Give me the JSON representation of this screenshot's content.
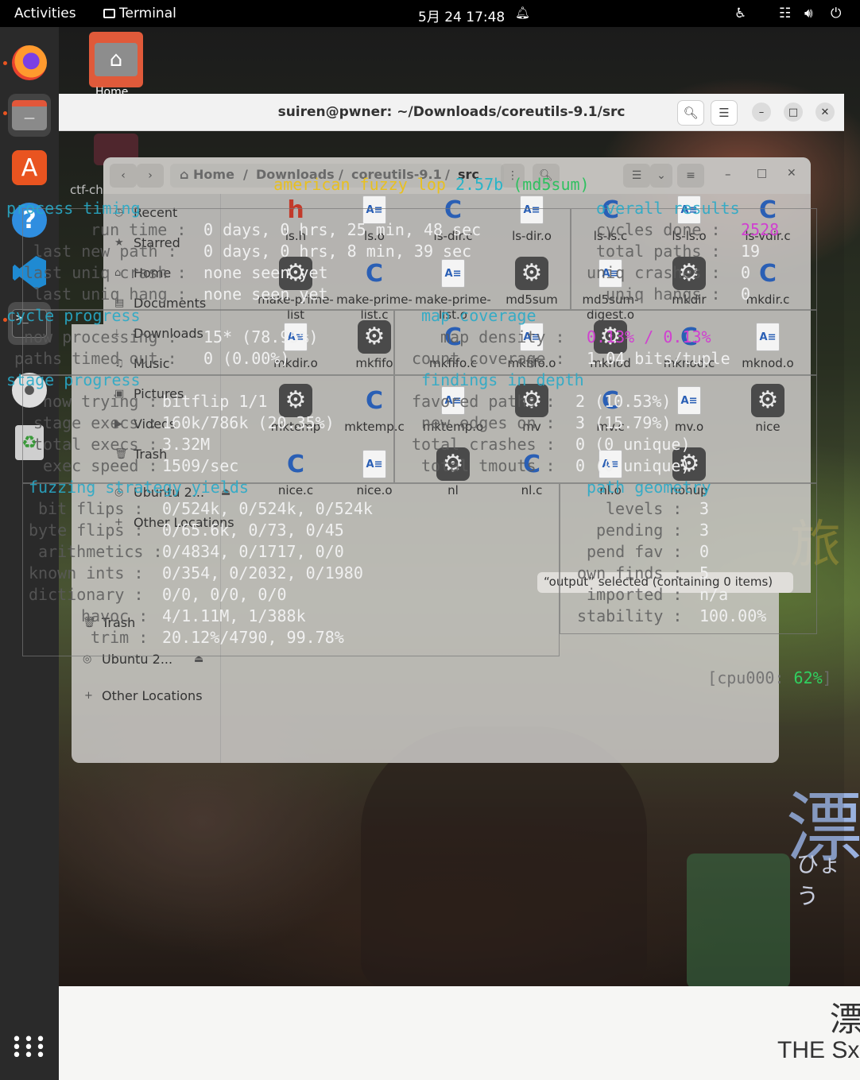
{
  "topbar": {
    "activities": "Activities",
    "app": "Terminal",
    "clock": "5月 24  17:48"
  },
  "dock": {
    "items": [
      "firefox",
      "files",
      "app-center",
      "help",
      "vscode",
      "terminal",
      "disc",
      "trash",
      "show-apps"
    ]
  },
  "desktop": {
    "home_label": "Home",
    "ctf_label": "ctf-ch"
  },
  "terminal": {
    "title": "suiren@pwner: ~/Downloads/coreutils-9.1/src"
  },
  "files": {
    "path": [
      "Home",
      "Downloads",
      "coreutils-9.1",
      "src"
    ],
    "sidebar": [
      "Recent",
      "Starred",
      "Home",
      "Documents",
      "Downloads",
      "Music",
      "Pictures",
      "Videos",
      "Trash",
      "Ubuntu 2...",
      "Other Locations"
    ],
    "lower_sidebar": [
      "Trash",
      "Ubuntu 2...",
      "Other Locations"
    ],
    "status": "“output” selected (containing 0 items)",
    "files": [
      {
        "name": "ls.h",
        "type": "h"
      },
      {
        "name": "ls.o",
        "type": "a"
      },
      {
        "name": "ls-dir.c",
        "type": "c"
      },
      {
        "name": "ls-dir.o",
        "type": "a"
      },
      {
        "name": "ls-ls.c",
        "type": "c"
      },
      {
        "name": "ls-ls.o",
        "type": "a"
      },
      {
        "name": "ls-vdir.c",
        "type": "c"
      },
      {
        "name": "make-prime-list",
        "type": "gear"
      },
      {
        "name": "make-prime-list.c",
        "type": "c"
      },
      {
        "name": "make-prime-list.o",
        "type": "a"
      },
      {
        "name": "md5sum",
        "type": "gear"
      },
      {
        "name": "md5sum-digest.o",
        "type": "a"
      },
      {
        "name": "mkdir",
        "type": "gear"
      },
      {
        "name": "mkdir.c",
        "type": "c"
      },
      {
        "name": "mkdir.o",
        "type": "a"
      },
      {
        "name": "mkfifo",
        "type": "gear"
      },
      {
        "name": "mkfifo.c",
        "type": "c"
      },
      {
        "name": "mkfifo.o",
        "type": "a"
      },
      {
        "name": "mknod",
        "type": "gear"
      },
      {
        "name": "mknod.c",
        "type": "c"
      },
      {
        "name": "mknod.o",
        "type": "a"
      },
      {
        "name": "mktemp",
        "type": "gear"
      },
      {
        "name": "mktemp.c",
        "type": "c"
      },
      {
        "name": "mktemp.o",
        "type": "a"
      },
      {
        "name": "mv",
        "type": "gear"
      },
      {
        "name": "mv.c",
        "type": "c"
      },
      {
        "name": "mv.o",
        "type": "a"
      },
      {
        "name": "nice",
        "type": "gear"
      },
      {
        "name": "nice.c",
        "type": "c"
      },
      {
        "name": "nice.o",
        "type": "a"
      },
      {
        "name": "nl",
        "type": "gear"
      },
      {
        "name": "nl.c",
        "type": "c"
      },
      {
        "name": "nl.o",
        "type": "a"
      },
      {
        "name": "nohup",
        "type": "gear"
      }
    ]
  },
  "afl": {
    "banner": "american fuzzy lop",
    "version": "2.57b",
    "target": "(md5sum)",
    "process_timing": "process timing",
    "run_time_label": "run time :",
    "run_time": "0 days, 0 hrs, 25 min, 48 sec",
    "last_path_label": "last new path :",
    "last_path": "0 days, 0 hrs, 8 min, 39 sec",
    "last_crash_label": "last uniq crash :",
    "last_crash": "none seen yet",
    "last_hang_label": "last uniq hang :",
    "last_hang": "none seen yet",
    "overall_results": "overall results",
    "cycles_done_label": "cycles done :",
    "cycles_done": "2528",
    "total_paths_label": "total paths :",
    "total_paths": "19",
    "uniq_crashes_label": "uniq crashes :",
    "uniq_crashes": "0",
    "uniq_hangs_label": "uniq hangs :",
    "uniq_hangs": "0",
    "cycle_progress": "cycle progress",
    "now_processing_label": "now processing :",
    "now_processing": "15* (78.95%)",
    "timed_out_label": "paths timed out :",
    "timed_out": "0 (0.00%)",
    "map_coverage": "map coverage",
    "map_density_label": "map density :",
    "map_density": "0.13% / 0.13%",
    "count_coverage_label": "count coverage :",
    "count_coverage": "1.04 bits/tuple",
    "stage_progress": "stage progress",
    "now_trying_label": "now trying :",
    "now_trying": "bitflip 1/1",
    "stage_execs_label": "stage execs :",
    "stage_execs": "160k/786k (20.35%)",
    "total_execs_label": "total execs :",
    "total_execs": "3.32M",
    "exec_speed_label": "exec speed :",
    "exec_speed": "1509/sec",
    "findings": "findings in depth",
    "favored_label": "favored paths :",
    "favored": "2 (10.53%)",
    "new_edges_label": "new edges on :",
    "new_edges": "3 (15.79%)",
    "total_crashes_label": "total crashes :",
    "total_crashes": "0 (0 unique)",
    "total_tmouts_label": "total tmouts :",
    "total_tmouts": "0 (0 unique)",
    "strategy": "fuzzing strategy yields",
    "bit_flips_label": "bit flips :",
    "bit_flips": "0/524k, 0/524k, 0/524k",
    "byte_flips_label": "byte flips :",
    "byte_flips": "0/65.6k, 0/73, 0/45",
    "arithmetics_label": "arithmetics :",
    "arithmetics": "0/4834, 0/1717, 0/0",
    "known_ints_label": "known ints :",
    "known_ints": "0/354, 0/2032, 0/1980",
    "dictionary_label": "dictionary :",
    "dictionary": "0/0, 0/0, 0/0",
    "havoc_label": "havoc :",
    "havoc": "4/1.11M, 1/388k",
    "trim_label": "trim :",
    "trim": "20.12%/4790, 99.78%",
    "path_geometry": "path geometry",
    "levels_label": "levels :",
    "levels": "3",
    "pending_label": "pending :",
    "pending": "3",
    "pend_fav_label": "pend fav :",
    "pend_fav": "0",
    "own_finds_label": "own finds :",
    "own_finds": "5",
    "imported_label": "imported :",
    "imported": "n/a",
    "stability_label": "stability :",
    "stability": "100.00%",
    "cpu_label": "[cpu000:",
    "cpu": "62%",
    "cpu_close": "]"
  },
  "wallpaper": {
    "kanji": "漂",
    "kana": "ひょう",
    "brand": "THE SxP",
    "side_kanji": "旅"
  },
  "colors": {
    "ubuntu_orange": "#e95420",
    "afl_yellow": "#e8c020",
    "afl_cyan": "#28b4c8",
    "afl_magenta": "#d040d0",
    "afl_green": "#30d060"
  }
}
